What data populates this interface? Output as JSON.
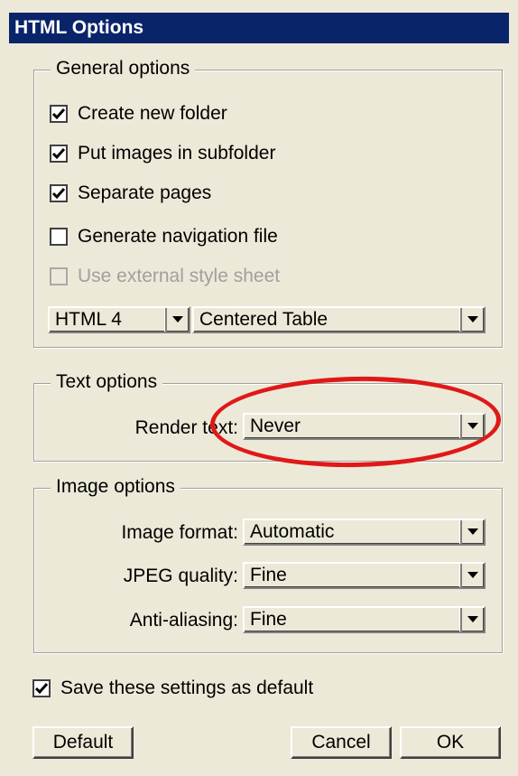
{
  "dialog": {
    "title": "HTML Options"
  },
  "general": {
    "legend": "General options",
    "options": [
      {
        "label": "Create new folder",
        "checked": true,
        "enabled": true
      },
      {
        "label": "Put images in subfolder",
        "checked": true,
        "enabled": true
      },
      {
        "label": "Separate pages",
        "checked": true,
        "enabled": true
      },
      {
        "label": "Generate navigation file",
        "checked": false,
        "enabled": true
      },
      {
        "label": "Use external style sheet",
        "checked": false,
        "enabled": false
      }
    ],
    "html_version": "HTML 4",
    "layout": "Centered Table"
  },
  "text": {
    "legend": "Text options",
    "render_label": "Render text:",
    "render_value": "Never"
  },
  "image": {
    "legend": "Image options",
    "format_label": "Image format:",
    "format_value": "Automatic",
    "jpeg_label": "JPEG quality:",
    "jpeg_value": "Fine",
    "aa_label": "Anti-aliasing:",
    "aa_value": "Fine"
  },
  "save_default": {
    "label": "Save these settings as default",
    "checked": true
  },
  "buttons": {
    "default": "Default",
    "cancel": "Cancel",
    "ok": "OK"
  },
  "annotation": {
    "color": "#e01818",
    "target": "Render text combo"
  }
}
